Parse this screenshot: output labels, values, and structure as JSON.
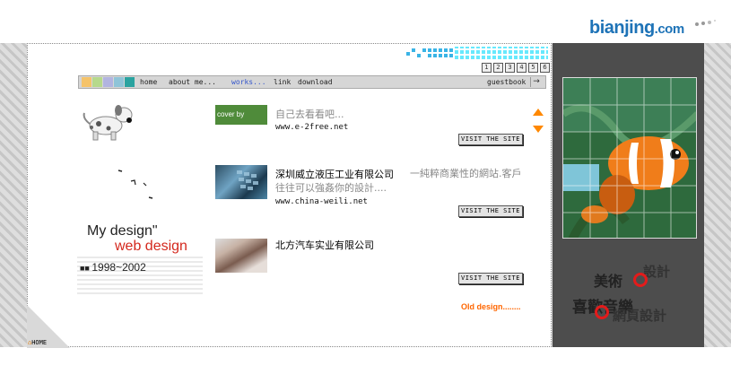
{
  "brand": {
    "logo_main": "bianjing",
    "logo_sub": ".com"
  },
  "pages": [
    "1",
    "2",
    "3",
    "4",
    "5",
    "6"
  ],
  "nav": {
    "chip_colors": [
      "#f5c36a",
      "#b6d98c",
      "#b2b4e0",
      "#8fc4d8",
      "#2aa3a0"
    ],
    "items": [
      "home",
      "about me...",
      "works...",
      "link",
      "download"
    ],
    "active": "works...",
    "guestbook": "guestbook",
    "arrow": "→"
  },
  "works": [
    {
      "thumb_label": "cover by",
      "title": "",
      "desc": "自己去看看吧...",
      "url": "www.e-2free.net",
      "button": "VISIT THE SITE"
    },
    {
      "title": "深圳威立液压工业有限公司",
      "desc": "一純粹商業性的網站.客戶往往可以強姦你的設計....",
      "url": "www.china-weili.net",
      "button": "VISIT THE SITE"
    },
    {
      "title": "北方汽车实业有限公司",
      "desc": "",
      "url": "",
      "button": "VISIT THE SITE"
    }
  ],
  "old_design": "Old design........",
  "intro": {
    "line1": "My design\"",
    "line2": "web design",
    "line3": "1998~2002"
  },
  "home_label": "HOME",
  "side": {
    "t1": "美術",
    "t2": "設計",
    "t3": "喜歡音樂",
    "t4": "網頁設計"
  },
  "colors": {
    "accent": "#ff6600",
    "link_blue": "#1e73b7",
    "side_bg": "#4d4d4d"
  }
}
